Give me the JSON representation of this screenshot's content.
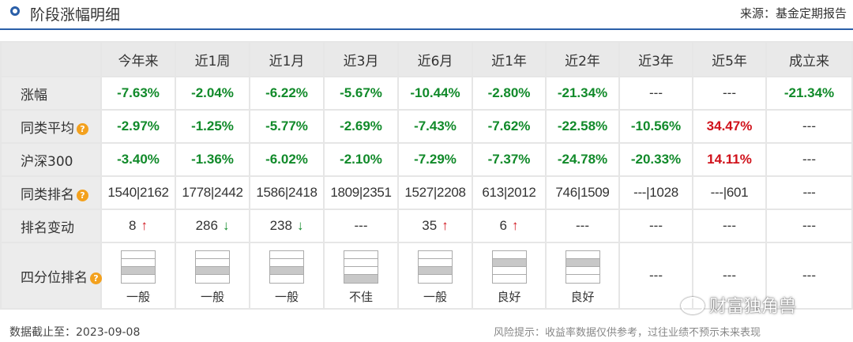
{
  "header": {
    "title": "阶段涨幅明细",
    "source": "来源：基金定期报告"
  },
  "columns": [
    "今年来",
    "近1周",
    "近1月",
    "近3月",
    "近6月",
    "近1年",
    "近2年",
    "近3年",
    "近5年",
    "成立来"
  ],
  "rows": {
    "change": {
      "label": "涨幅",
      "values": [
        "-7.63%",
        "-2.04%",
        "-6.22%",
        "-5.67%",
        "-10.44%",
        "-2.80%",
        "-21.34%",
        "---",
        "---",
        "-21.34%"
      ],
      "colors": [
        "green",
        "green",
        "green",
        "green",
        "green",
        "green",
        "green",
        "plain",
        "plain",
        "green"
      ]
    },
    "peer_avg": {
      "label": "同类平均",
      "values": [
        "-2.97%",
        "-1.25%",
        "-5.77%",
        "-2.69%",
        "-7.43%",
        "-7.62%",
        "-22.58%",
        "-10.56%",
        "34.47%",
        "---"
      ],
      "colors": [
        "green",
        "green",
        "green",
        "green",
        "green",
        "green",
        "green",
        "green",
        "red",
        "plain"
      ]
    },
    "hs300": {
      "label": "沪深300",
      "values": [
        "-3.40%",
        "-1.36%",
        "-6.02%",
        "-2.10%",
        "-7.29%",
        "-7.37%",
        "-24.78%",
        "-20.33%",
        "14.11%",
        "---"
      ],
      "colors": [
        "green",
        "green",
        "green",
        "green",
        "green",
        "green",
        "green",
        "green",
        "red",
        "plain"
      ]
    },
    "peer_rank": {
      "label": "同类排名",
      "values": [
        "1540|2162",
        "1778|2442",
        "1586|2418",
        "1809|2351",
        "1527|2208",
        "613|2012",
        "746|1509",
        "---|1028",
        "---|601",
        "---"
      ]
    },
    "rank_change": {
      "label": "排名变动",
      "values": [
        "8",
        "286",
        "238",
        "---",
        "35",
        "6",
        "---",
        "---",
        "---",
        "---"
      ],
      "arrows": [
        "up",
        "down",
        "down",
        "",
        "up",
        "up",
        "",
        "",
        "",
        ""
      ]
    },
    "quartile": {
      "label": "四分位排名",
      "labels": [
        "一般",
        "一般",
        "一般",
        "不佳",
        "一般",
        "良好",
        "良好",
        "---",
        "---",
        "---"
      ],
      "filled_band": [
        3,
        3,
        3,
        4,
        3,
        2,
        2,
        0,
        0,
        0
      ]
    }
  },
  "footer": {
    "date_label": "数据截止至：2023-09-08",
    "risk_note": "风险提示：收益率数据仅供参考，过往业绩不预示未来表现"
  },
  "watermark": "财富独角兽",
  "icons": {
    "header_marker": "circle-icon",
    "help": "question-icon",
    "up": "arrow-up-icon",
    "down": "arrow-down-icon"
  },
  "colors": {
    "accent": "#2a5fa8",
    "positive": "#d0121b",
    "negative": "#118a2a",
    "help_badge": "#f3a11e"
  }
}
